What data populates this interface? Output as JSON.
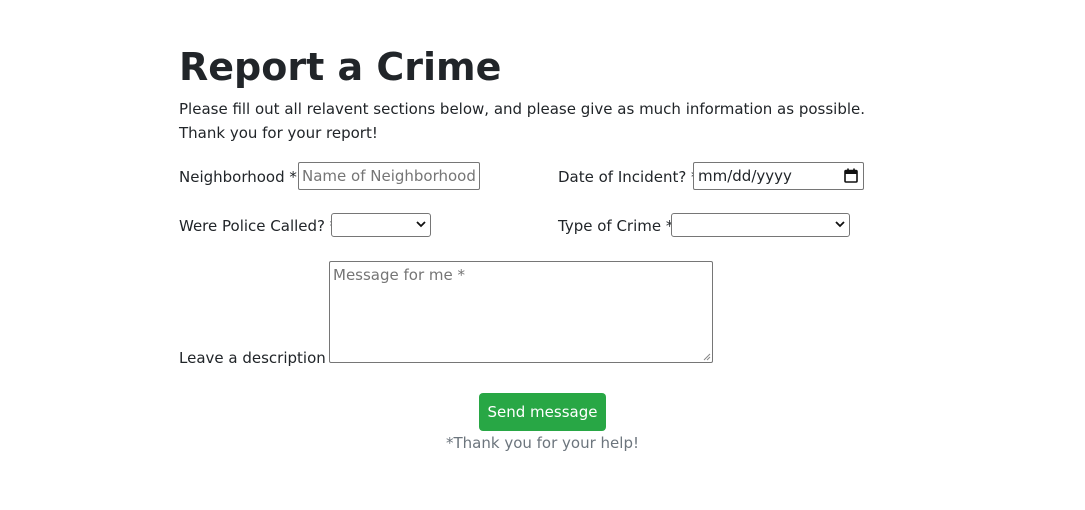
{
  "page": {
    "title": "Report a Crime",
    "intro": "Please fill out all relavent sections below, and please give as much information as possible. Thank you for your report!"
  },
  "form": {
    "neighborhood": {
      "label": "Neighborhood *",
      "placeholder": "Name of Neighborhood",
      "value": ""
    },
    "date_of_incident": {
      "label": "Date of Incident? *",
      "value": "mm/dd/yyyy",
      "icon": "calendar-icon"
    },
    "police_called": {
      "label": "Were Police Called? *",
      "selected": "",
      "icon": "chevron-down-icon"
    },
    "crime_type": {
      "label": "Type of Crime *",
      "selected": "",
      "icon": "chevron-down-icon"
    },
    "description": {
      "label": "Leave a description *",
      "placeholder": "Message for me *",
      "value": ""
    },
    "submit_label": "Send message",
    "footer_note": "*Thank you for your help!"
  },
  "colors": {
    "button": "#28a745",
    "text": "#212529",
    "muted": "#6c757d"
  }
}
